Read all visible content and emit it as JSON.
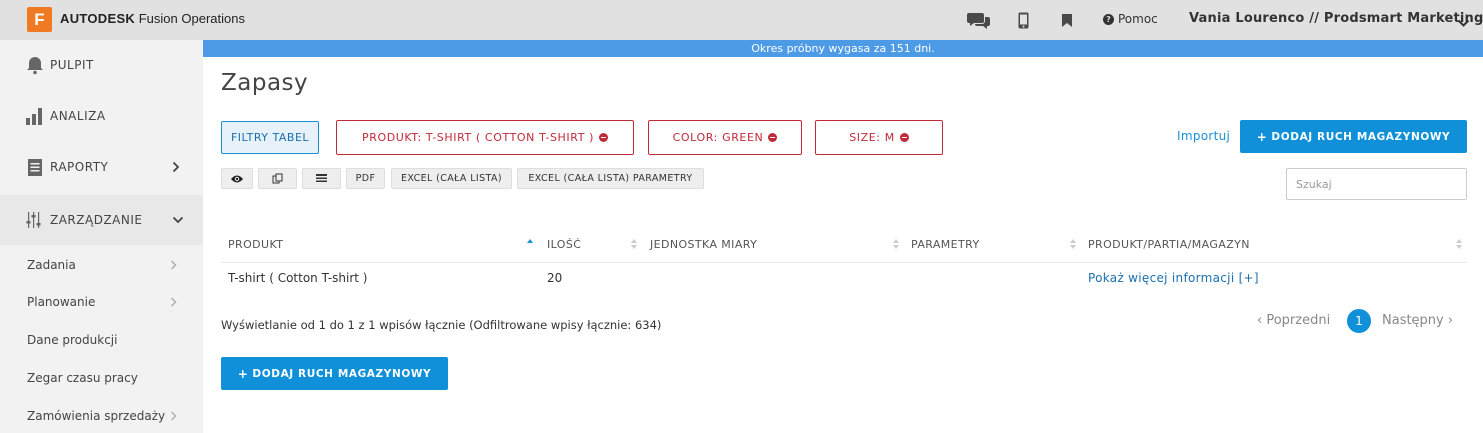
{
  "topbar": {
    "logo_letter": "F",
    "brand_bold": "AUTODESK",
    "brand_rest": " Fusion Operations",
    "help_label": "Pomoc",
    "user_label": "Vania Lourenco // Prodsmart Marketing",
    "icons": [
      "chat-icon",
      "mobile-icon",
      "bookmark-icon",
      "help-icon",
      "chevron-down-icon"
    ]
  },
  "sidebar": {
    "main": [
      {
        "label": "PULPIT",
        "icon": "bell-icon"
      },
      {
        "label": "ANALIZA",
        "icon": "bar-chart-icon"
      },
      {
        "label": "RAPORTY",
        "icon": "report-icon"
      },
      {
        "label": "ZARZĄDZANIE",
        "icon": "sliders-icon"
      }
    ],
    "sub": [
      {
        "label": "Zadania"
      },
      {
        "label": "Planowanie"
      },
      {
        "label": "Dane produkcji"
      },
      {
        "label": "Zegar czasu pracy"
      },
      {
        "label": "Zamówienia sprzedaży"
      }
    ]
  },
  "trial_banner": "Okres próbny wygasa za 151 dni.",
  "page_title": "Zapasy",
  "filters": {
    "toggle_label": "FILTRY TABEL",
    "chips": [
      {
        "label": "PRODUKT: T-SHIRT ( COTTON T-SHIRT )"
      },
      {
        "label": "COLOR: GREEN"
      },
      {
        "label": "SIZE: M"
      }
    ]
  },
  "actions": {
    "import_label": "Importuj",
    "add_label": "DODAJ RUCH MAGAZYNOWY"
  },
  "toolbar": {
    "pdf": "PDF",
    "excel": "EXCEL (CAŁA LISTA)",
    "excel_params": "EXCEL (CAŁA LISTA) PARAMETRY"
  },
  "search": {
    "placeholder": "Szukaj",
    "value": ""
  },
  "table": {
    "columns": [
      "PRODUKT",
      "ILOŚĆ",
      "JEDNOSTKA MIARY",
      "PARAMETRY",
      "PRODUKT/PARTIA/MAGAZYN"
    ],
    "rows": [
      {
        "produkt": "T-shirt ( Cotton T-shirt )",
        "ilosc": "20",
        "jednostka": "",
        "parametry": "",
        "link": "Pokaż więcej informacji [+]"
      }
    ]
  },
  "footer": {
    "info": "Wyświetlanie od 1 do 1 z 1 wpisów łącznie (Odfiltrowane wpisy łącznie: 634)",
    "prev": "Poprzedni",
    "current_page": "1",
    "next": "Następny"
  },
  "colors": {
    "accent": "#0f90d9",
    "trial_banner": "#4d9be6",
    "filter_chip": "#c12a38",
    "logo": "#f07a22"
  }
}
